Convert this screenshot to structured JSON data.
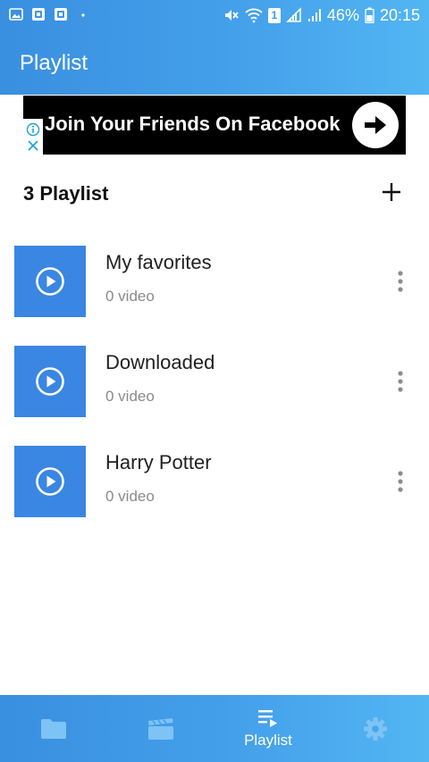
{
  "status_bar": {
    "battery_percent": "46%",
    "time": "20:15",
    "sim_badge": "1",
    "left_icons": [
      "gallery-icon",
      "app-icon",
      "app-icon",
      "dot-icon"
    ],
    "right_icons": [
      "mute-icon",
      "wifi-icon",
      "sim-icon",
      "signal-icon",
      "signal-icon",
      "battery-icon"
    ]
  },
  "header": {
    "title": "Playlist"
  },
  "ad": {
    "text": "Join Your Friends On Facebook",
    "cta_icon": "arrow-right-icon",
    "choices_icons": [
      "info-icon",
      "close-icon"
    ]
  },
  "section": {
    "title": "3 Playlist",
    "add_icon": "plus-icon"
  },
  "playlists": [
    {
      "name": "My favorites",
      "count": "0 video"
    },
    {
      "name": "Downloaded",
      "count": "0 video"
    },
    {
      "name": "Harry Potter",
      "count": "0 video"
    }
  ],
  "bottom_nav": {
    "items": [
      {
        "icon": "folder-icon",
        "label": ""
      },
      {
        "icon": "clapperboard-icon",
        "label": ""
      },
      {
        "icon": "playlist-icon",
        "label": "Playlist"
      },
      {
        "icon": "gear-icon",
        "label": ""
      }
    ]
  },
  "colors": {
    "accent": "#3a86e3",
    "header_gradient_start": "#3a8fe0",
    "header_gradient_end": "#52b6f3",
    "ad_background": "#000000",
    "nav_inactive_icon": "#7ec3f5"
  }
}
